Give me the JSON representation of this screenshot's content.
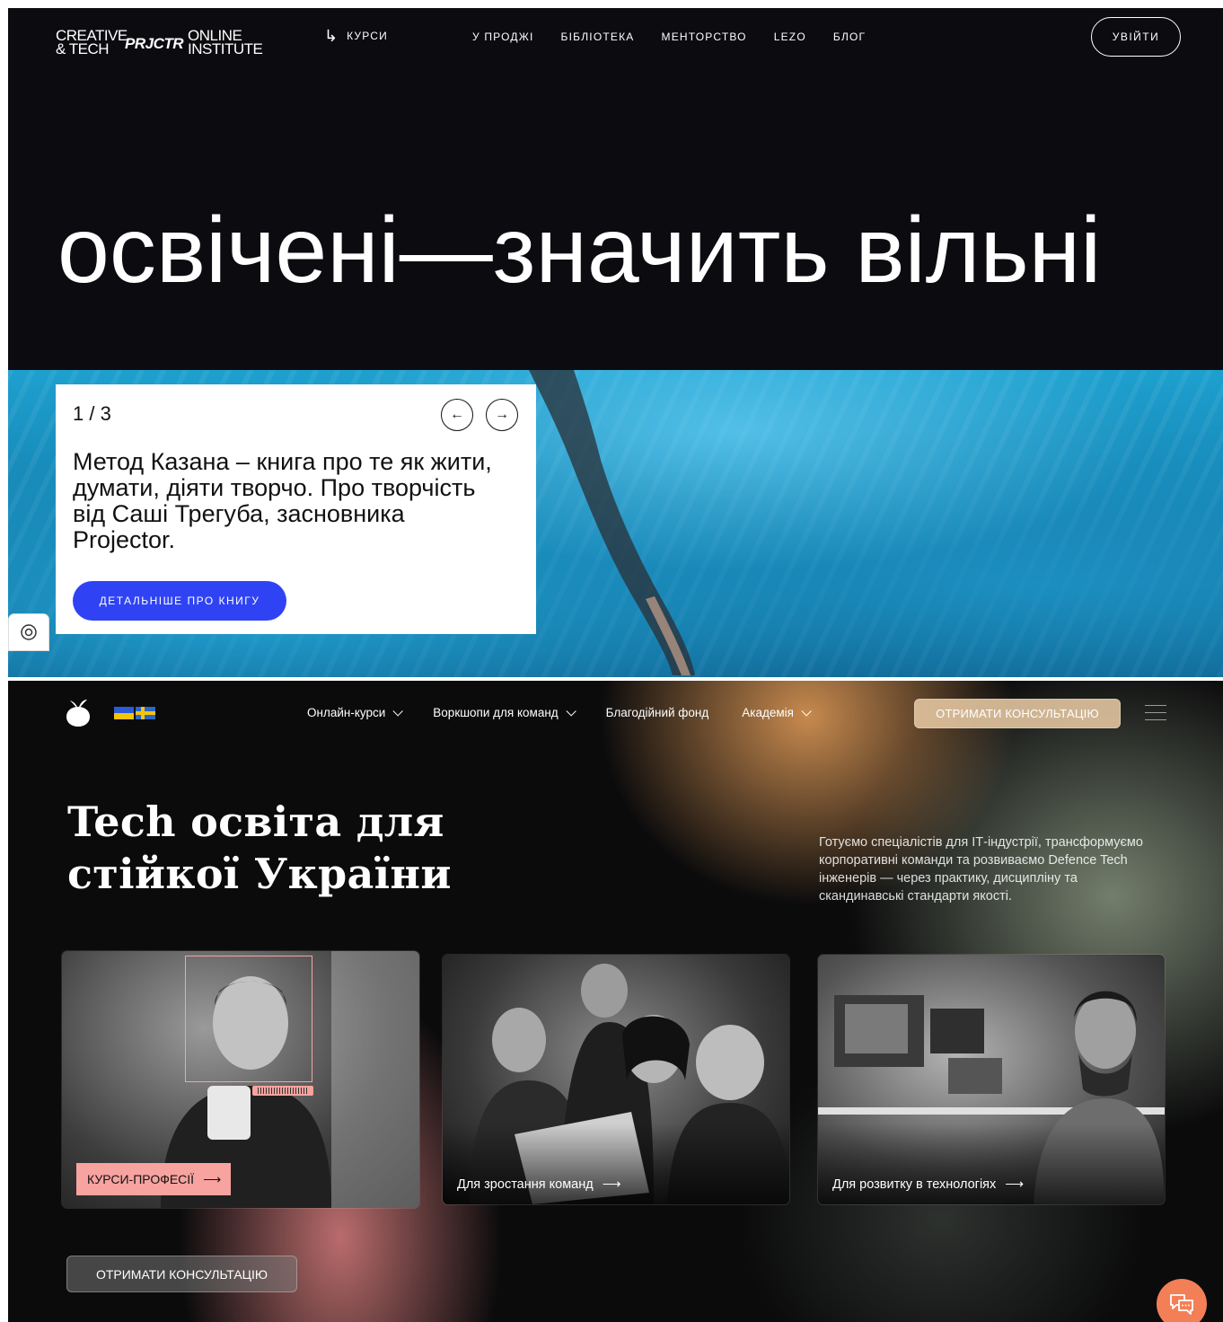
{
  "site1": {
    "logo": {
      "line1": "CREATIVE",
      "line2": "& TECH",
      "mark": "PRJCTR",
      "right1": "ONLINE",
      "right2": "INSTITUTE"
    },
    "courses_label": "КУРСИ",
    "nav": [
      "У ПРОДЖІ",
      "БІБЛІОТЕКА",
      "МЕНТОРСТВО",
      "LEZO",
      "БЛОГ"
    ],
    "login_label": "УВІЙТИ",
    "hero_title": "освічені—значить вільні",
    "card": {
      "counter": "1 / 3",
      "text": "Метод Казана – книга про те як жити, думати, діяти творчо. Про творчість від Саші Трегуба, засновника Projector.",
      "button": "ДЕТАЛЬНІШЕ ПРО КНИГУ",
      "prev_icon": "←",
      "next_icon": "→"
    }
  },
  "site2": {
    "nav": [
      {
        "label": "Онлайн-курси",
        "dropdown": true
      },
      {
        "label": "Воркшопи для команд",
        "dropdown": true
      },
      {
        "label": "Благодійний фонд",
        "dropdown": false
      },
      {
        "label": "Академія",
        "dropdown": true
      }
    ],
    "consult_top": "ОТРИМАТИ КОНСУЛЬТАЦІЮ",
    "title_line1": "Tech освіта для",
    "title_line2": "стійкої України",
    "description": "Готуємо спеціалістів для ІТ-індустрії, трансформуємо корпоративні команди та розвиваємо Defence Tech інженерів — через практику, дисципліну та скандинавські стандарти якості.",
    "cards": [
      {
        "label": "КУРСИ-ПРОФЕСІЇ",
        "arrow": "⟶"
      },
      {
        "label": "Для зростання команд",
        "arrow": "⟶"
      },
      {
        "label": "Для розвитку в технологіях",
        "arrow": "⟶"
      }
    ],
    "consult_bottom": "ОТРИМАТИ КОНСУЛЬТАЦІЮ"
  },
  "colors": {
    "site1_bg": "#0c0c10",
    "primary_blue": "#2f43f5",
    "pink": "#f7a3a0",
    "chat_orange": "#f37f57"
  }
}
